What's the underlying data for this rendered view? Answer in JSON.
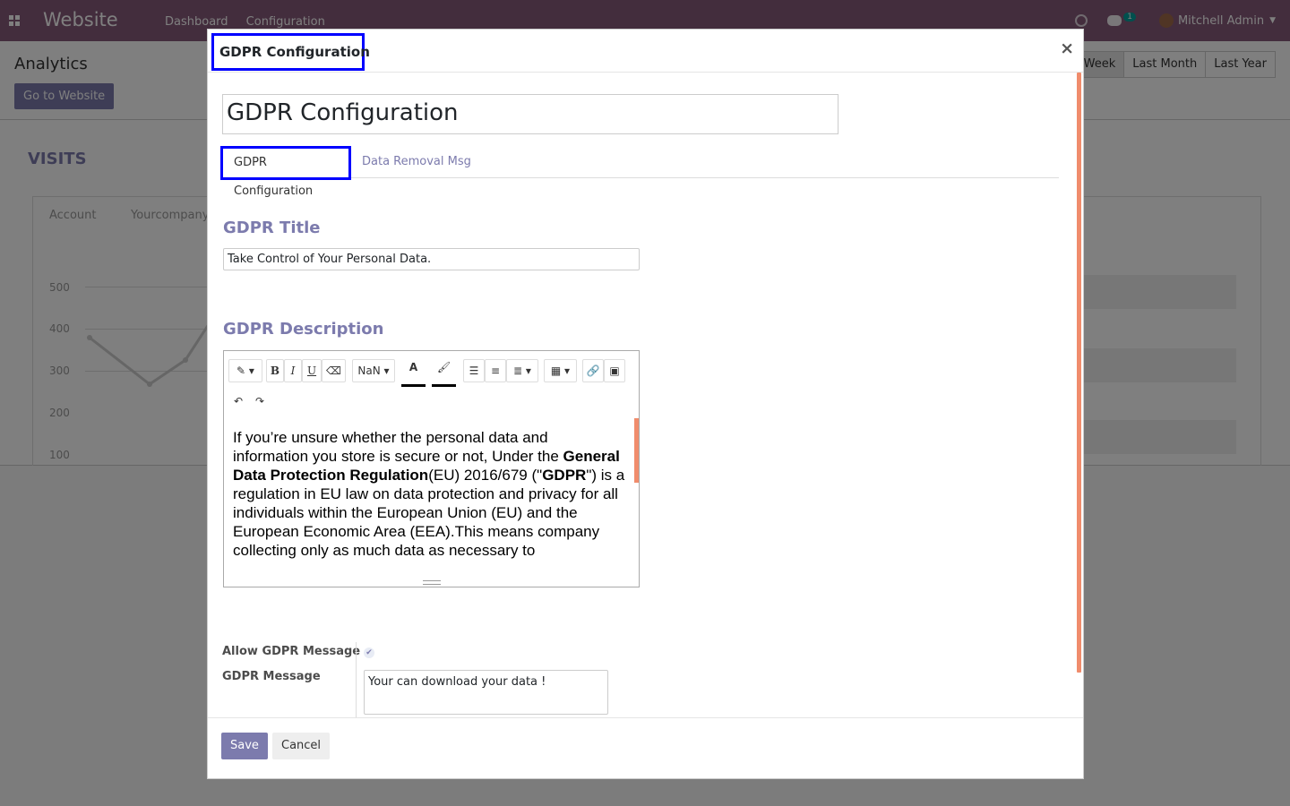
{
  "topbar": {
    "app_name": "Website",
    "menu": [
      "Dashboard",
      "Configuration"
    ],
    "chat_count": "1",
    "user": "Mitchell Admin",
    "icons": [
      "apps-icon",
      "clock-icon",
      "chat-icon",
      "avatar"
    ]
  },
  "control_panel": {
    "title": "Analytics",
    "goto_button": "Go to Website",
    "periods": [
      "st Week",
      "Last Month",
      "Last Year"
    ]
  },
  "dashboard": {
    "visits_title": "VISITS",
    "chart_tabs": [
      "Account",
      "Yourcompany"
    ],
    "y_labels": [
      "500",
      "400",
      "300",
      "200",
      "100"
    ]
  },
  "modal": {
    "title": "GDPR Configuration",
    "close_symbol": "×",
    "record_name": "GDPR Configuration",
    "tabs": [
      {
        "label": "GDPR Configuration",
        "active": true
      },
      {
        "label": "Data Removal Msg",
        "active": false
      }
    ],
    "gdpr_title_label": "GDPR Title",
    "gdpr_title_value": "Take Control of Your Personal Data.",
    "gdpr_description_label": "GDPR Description",
    "editor": {
      "font_size": "NaN",
      "text_color_glyph": "A",
      "description_html": "If you’re unsure whether the personal data and information you store is secure or not, Under the <b>General Data Protection Regulation</b>(EU) 2016/679 (\"<b>GDPR</b>\") is a regulation in EU law on data protection and privacy for all individuals within the European Union (EU) and the European Economic Area (EEA).This means company collecting only as much data as necessary to"
    },
    "allow_gdpr_label": "Allow GDPR Message",
    "allow_gdpr_checked": true,
    "gdpr_message_label": "GDPR Message",
    "gdpr_message_value": "Your can download your data !",
    "footer": {
      "save": "Save",
      "cancel": "Cancel"
    }
  }
}
